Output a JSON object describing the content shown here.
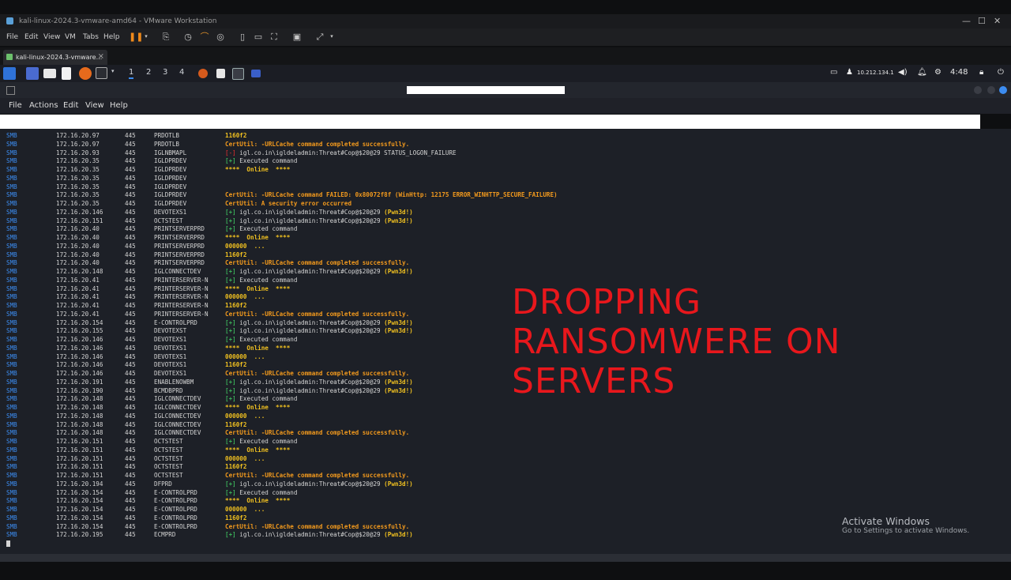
{
  "vm": {
    "title": "kali-linux-2024.3-vmware-amd64 - VMware Workstation",
    "menu": [
      "File",
      "Edit",
      "View",
      "VM",
      "Tabs",
      "Help"
    ],
    "tab_label": "kali-linux-2024.3-vmware...",
    "tab_close": "×"
  },
  "kali_panel": {
    "workspaces": [
      "1",
      "2",
      "3",
      "4"
    ],
    "ip": "10.212.134.1",
    "time": "4:48"
  },
  "terminal": {
    "menu": [
      "File",
      "Actions",
      "Edit",
      "View",
      "Help"
    ],
    "rows": [
      {
        "proto": "SMB",
        "ip": "172.16.20.97",
        "port": "445",
        "host": "PRDOTLB",
        "msg": [
          {
            "t": "1160f2",
            "c": "k-yellow"
          }
        ]
      },
      {
        "proto": "SMB",
        "ip": "172.16.20.97",
        "port": "445",
        "host": "PRDOTLB",
        "msg": [
          {
            "t": "CertUtil: -URLCache command completed successfully.",
            "c": "k-orange"
          }
        ]
      },
      {
        "proto": "SMB",
        "ip": "172.16.20.93",
        "port": "445",
        "host": "IGLNBMAPL",
        "msg": [
          {
            "t": "[-] ",
            "c": "k-red"
          },
          {
            "t": "igl.co.in\\igldeladmin:Threat#Cop@$20@29 STATUS_LOGON_FAILURE",
            "c": "k-white"
          }
        ]
      },
      {
        "proto": "SMB",
        "ip": "172.16.20.35",
        "port": "445",
        "host": "IGLDPRDEV",
        "msg": [
          {
            "t": "[+] ",
            "c": "k-green"
          },
          {
            "t": "Executed command",
            "c": "k-white"
          }
        ]
      },
      {
        "proto": "SMB",
        "ip": "172.16.20.35",
        "port": "445",
        "host": "IGLDPRDEV",
        "msg": [
          {
            "t": "****  Online  ****",
            "c": "k-yellow"
          }
        ]
      },
      {
        "proto": "SMB",
        "ip": "172.16.20.35",
        "port": "445",
        "host": "IGLDPRDEV",
        "msg": []
      },
      {
        "proto": "SMB",
        "ip": "172.16.20.35",
        "port": "445",
        "host": "IGLDPRDEV",
        "msg": []
      },
      {
        "proto": "SMB",
        "ip": "172.16.20.35",
        "port": "445",
        "host": "IGLDPRDEV",
        "msg": [
          {
            "t": "CertUtil: -URLCache command FAILED: 0x80072f8f (WinHttp: 12175 ERROR_WINHTTP_SECURE_FAILURE)",
            "c": "k-orange"
          }
        ]
      },
      {
        "proto": "SMB",
        "ip": "172.16.20.35",
        "port": "445",
        "host": "IGLDPRDEV",
        "msg": [
          {
            "t": "CertUtil: A security error occurred",
            "c": "k-orange"
          }
        ]
      },
      {
        "proto": "SMB",
        "ip": "172.16.20.146",
        "port": "445",
        "host": "DEVOTEXS1",
        "msg": [
          {
            "t": "[+] ",
            "c": "k-green"
          },
          {
            "t": "igl.co.in\\igldeladmin:Threat#Cop@$20@29 ",
            "c": "k-white"
          },
          {
            "t": "(Pwn3d!)",
            "c": "k-yellow"
          }
        ]
      },
      {
        "proto": "SMB",
        "ip": "172.16.20.151",
        "port": "445",
        "host": "OCTSTEST",
        "msg": [
          {
            "t": "[+] ",
            "c": "k-green"
          },
          {
            "t": "igl.co.in\\igldeladmin:Threat#Cop@$20@29 ",
            "c": "k-white"
          },
          {
            "t": "(Pwn3d!)",
            "c": "k-yellow"
          }
        ]
      },
      {
        "proto": "SMB",
        "ip": "172.16.20.40",
        "port": "445",
        "host": "PRINTSERVERPRD",
        "msg": [
          {
            "t": "[+] ",
            "c": "k-green"
          },
          {
            "t": "Executed command",
            "c": "k-white"
          }
        ]
      },
      {
        "proto": "SMB",
        "ip": "172.16.20.40",
        "port": "445",
        "host": "PRINTSERVERPRD",
        "msg": [
          {
            "t": "****  Online  ****",
            "c": "k-yellow"
          }
        ]
      },
      {
        "proto": "SMB",
        "ip": "172.16.20.40",
        "port": "445",
        "host": "PRINTSERVERPRD",
        "msg": [
          {
            "t": "000000  ...",
            "c": "k-yellow"
          }
        ]
      },
      {
        "proto": "SMB",
        "ip": "172.16.20.40",
        "port": "445",
        "host": "PRINTSERVERPRD",
        "msg": [
          {
            "t": "1160f2",
            "c": "k-yellow"
          }
        ]
      },
      {
        "proto": "SMB",
        "ip": "172.16.20.40",
        "port": "445",
        "host": "PRINTSERVERPRD",
        "msg": [
          {
            "t": "CertUtil: -URLCache command completed successfully.",
            "c": "k-orange"
          }
        ]
      },
      {
        "proto": "SMB",
        "ip": "172.16.20.148",
        "port": "445",
        "host": "IGLCONNECTDEV",
        "msg": [
          {
            "t": "[+] ",
            "c": "k-green"
          },
          {
            "t": "igl.co.in\\igldeladmin:Threat#Cop@$20@29 ",
            "c": "k-white"
          },
          {
            "t": "(Pwn3d!)",
            "c": "k-yellow"
          }
        ]
      },
      {
        "proto": "SMB",
        "ip": "172.16.20.41",
        "port": "445",
        "host": "PRINTERSERVER-N",
        "msg": [
          {
            "t": "[+] ",
            "c": "k-green"
          },
          {
            "t": "Executed command",
            "c": "k-white"
          }
        ]
      },
      {
        "proto": "SMB",
        "ip": "172.16.20.41",
        "port": "445",
        "host": "PRINTERSERVER-N",
        "msg": [
          {
            "t": "****  Online  ****",
            "c": "k-yellow"
          }
        ]
      },
      {
        "proto": "SMB",
        "ip": "172.16.20.41",
        "port": "445",
        "host": "PRINTERSERVER-N",
        "msg": [
          {
            "t": "000000  ...",
            "c": "k-yellow"
          }
        ]
      },
      {
        "proto": "SMB",
        "ip": "172.16.20.41",
        "port": "445",
        "host": "PRINTERSERVER-N",
        "msg": [
          {
            "t": "1160f2",
            "c": "k-yellow"
          }
        ]
      },
      {
        "proto": "SMB",
        "ip": "172.16.20.41",
        "port": "445",
        "host": "PRINTERSERVER-N",
        "msg": [
          {
            "t": "CertUtil: -URLCache command completed successfully.",
            "c": "k-orange"
          }
        ]
      },
      {
        "proto": "SMB",
        "ip": "172.16.20.154",
        "port": "445",
        "host": "E-CONTROLPRD",
        "msg": [
          {
            "t": "[+] ",
            "c": "k-green"
          },
          {
            "t": "igl.co.in\\igldeladmin:Threat#Cop@$20@29 ",
            "c": "k-white"
          },
          {
            "t": "(Pwn3d!)",
            "c": "k-yellow"
          }
        ]
      },
      {
        "proto": "SMB",
        "ip": "172.16.20.155",
        "port": "445",
        "host": "DEVOTEXST",
        "msg": [
          {
            "t": "[+] ",
            "c": "k-green"
          },
          {
            "t": "igl.co.in\\igldeladmin:Threat#Cop@$20@29 ",
            "c": "k-white"
          },
          {
            "t": "(Pwn3d!)",
            "c": "k-yellow"
          }
        ]
      },
      {
        "proto": "SMB",
        "ip": "172.16.20.146",
        "port": "445",
        "host": "DEVOTEXS1",
        "msg": [
          {
            "t": "[+] ",
            "c": "k-green"
          },
          {
            "t": "Executed command",
            "c": "k-white"
          }
        ]
      },
      {
        "proto": "SMB",
        "ip": "172.16.20.146",
        "port": "445",
        "host": "DEVOTEXS1",
        "msg": [
          {
            "t": "****  Online  ****",
            "c": "k-yellow"
          }
        ]
      },
      {
        "proto": "SMB",
        "ip": "172.16.20.146",
        "port": "445",
        "host": "DEVOTEXS1",
        "msg": [
          {
            "t": "000000  ...",
            "c": "k-yellow"
          }
        ]
      },
      {
        "proto": "SMB",
        "ip": "172.16.20.146",
        "port": "445",
        "host": "DEVOTEXS1",
        "msg": [
          {
            "t": "1160f2",
            "c": "k-yellow"
          }
        ]
      },
      {
        "proto": "SMB",
        "ip": "172.16.20.146",
        "port": "445",
        "host": "DEVOTEXS1",
        "msg": [
          {
            "t": "CertUtil: -URLCache command completed successfully.",
            "c": "k-orange"
          }
        ]
      },
      {
        "proto": "SMB",
        "ip": "172.16.20.191",
        "port": "445",
        "host": "ENABLENOWBM",
        "msg": [
          {
            "t": "[+] ",
            "c": "k-green"
          },
          {
            "t": "igl.co.in\\igldeladmin:Threat#Cop@$20@29 ",
            "c": "k-white"
          },
          {
            "t": "(Pwn3d!)",
            "c": "k-yellow"
          }
        ]
      },
      {
        "proto": "SMB",
        "ip": "172.16.20.190",
        "port": "445",
        "host": "BCMDBPRD",
        "msg": [
          {
            "t": "[+] ",
            "c": "k-green"
          },
          {
            "t": "igl.co.in\\igldeladmin:Threat#Cop@$20@29 ",
            "c": "k-white"
          },
          {
            "t": "(Pwn3d!)",
            "c": "k-yellow"
          }
        ]
      },
      {
        "proto": "SMB",
        "ip": "172.16.20.148",
        "port": "445",
        "host": "IGLCONNECTDEV",
        "msg": [
          {
            "t": "[+] ",
            "c": "k-green"
          },
          {
            "t": "Executed command",
            "c": "k-white"
          }
        ]
      },
      {
        "proto": "SMB",
        "ip": "172.16.20.148",
        "port": "445",
        "host": "IGLCONNECTDEV",
        "msg": [
          {
            "t": "****  Online  ****",
            "c": "k-yellow"
          }
        ]
      },
      {
        "proto": "SMB",
        "ip": "172.16.20.148",
        "port": "445",
        "host": "IGLCONNECTDEV",
        "msg": [
          {
            "t": "000000  ...",
            "c": "k-yellow"
          }
        ]
      },
      {
        "proto": "SMB",
        "ip": "172.16.20.148",
        "port": "445",
        "host": "IGLCONNECTDEV",
        "msg": [
          {
            "t": "1160f2",
            "c": "k-yellow"
          }
        ]
      },
      {
        "proto": "SMB",
        "ip": "172.16.20.148",
        "port": "445",
        "host": "IGLCONNECTDEV",
        "msg": [
          {
            "t": "CertUtil: -URLCache command completed successfully.",
            "c": "k-orange"
          }
        ]
      },
      {
        "proto": "SMB",
        "ip": "172.16.20.151",
        "port": "445",
        "host": "OCTSTEST",
        "msg": [
          {
            "t": "[+] ",
            "c": "k-green"
          },
          {
            "t": "Executed command",
            "c": "k-white"
          }
        ]
      },
      {
        "proto": "SMB",
        "ip": "172.16.20.151",
        "port": "445",
        "host": "OCTSTEST",
        "msg": [
          {
            "t": "****  Online  ****",
            "c": "k-yellow"
          }
        ]
      },
      {
        "proto": "SMB",
        "ip": "172.16.20.151",
        "port": "445",
        "host": "OCTSTEST",
        "msg": [
          {
            "t": "000000  ...",
            "c": "k-yellow"
          }
        ]
      },
      {
        "proto": "SMB",
        "ip": "172.16.20.151",
        "port": "445",
        "host": "OCTSTEST",
        "msg": [
          {
            "t": "1160f2",
            "c": "k-yellow"
          }
        ]
      },
      {
        "proto": "SMB",
        "ip": "172.16.20.151",
        "port": "445",
        "host": "OCTSTEST",
        "msg": [
          {
            "t": "CertUtil: -URLCache command completed successfully.",
            "c": "k-orange"
          }
        ]
      },
      {
        "proto": "SMB",
        "ip": "172.16.20.194",
        "port": "445",
        "host": "DFPRD",
        "msg": [
          {
            "t": "[+] ",
            "c": "k-green"
          },
          {
            "t": "igl.co.in\\igldeladmin:Threat#Cop@$20@29 ",
            "c": "k-white"
          },
          {
            "t": "(Pwn3d!)",
            "c": "k-yellow"
          }
        ]
      },
      {
        "proto": "SMB",
        "ip": "172.16.20.154",
        "port": "445",
        "host": "E-CONTROLPRD",
        "msg": [
          {
            "t": "[+] ",
            "c": "k-green"
          },
          {
            "t": "Executed command",
            "c": "k-white"
          }
        ]
      },
      {
        "proto": "SMB",
        "ip": "172.16.20.154",
        "port": "445",
        "host": "E-CONTROLPRD",
        "msg": [
          {
            "t": "****  Online  ****",
            "c": "k-yellow"
          }
        ]
      },
      {
        "proto": "SMB",
        "ip": "172.16.20.154",
        "port": "445",
        "host": "E-CONTROLPRD",
        "msg": [
          {
            "t": "000000  ...",
            "c": "k-yellow"
          }
        ]
      },
      {
        "proto": "SMB",
        "ip": "172.16.20.154",
        "port": "445",
        "host": "E-CONTROLPRD",
        "msg": [
          {
            "t": "1160f2",
            "c": "k-yellow"
          }
        ]
      },
      {
        "proto": "SMB",
        "ip": "172.16.20.154",
        "port": "445",
        "host": "E-CONTROLPRD",
        "msg": [
          {
            "t": "CertUtil: -URLCache command completed successfully.",
            "c": "k-orange"
          }
        ]
      },
      {
        "proto": "SMB",
        "ip": "172.16.20.195",
        "port": "445",
        "host": "ECMPRD",
        "msg": [
          {
            "t": "[+] ",
            "c": "k-green"
          },
          {
            "t": "igl.co.in\\igldeladmin:Threat#Cop@$20@29 ",
            "c": "k-white"
          },
          {
            "t": "(Pwn3d!)",
            "c": "k-yellow"
          }
        ]
      }
    ]
  },
  "overlay": {
    "lines": [
      "DROPPING",
      "RANSOMWERE ON",
      "SERVERS"
    ],
    "color": "#e8171c"
  },
  "watermark": {
    "heading": "Activate Windows",
    "subtext": "Go to Settings to activate Windows."
  },
  "colors": {
    "proto": "#3c8cf0",
    "success": "#45e06a",
    "failure": "#f03030",
    "certutil": "#f39a1d",
    "highlight": "#f0c020"
  },
  "icons": [
    "kali-dragon-icon",
    "files-icon",
    "folder-icon",
    "text-editor-icon",
    "firefox-icon",
    "terminal-icon",
    "pause-icon",
    "snapshot-icon",
    "fullscreen-icon",
    "bell-icon",
    "power-icon",
    "lock-icon",
    "refresh-icon"
  ]
}
